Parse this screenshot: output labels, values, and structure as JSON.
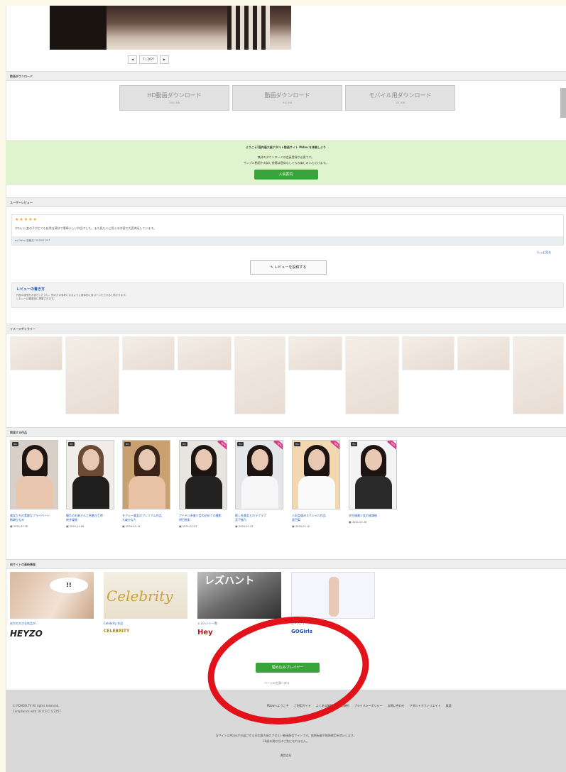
{
  "pager": {
    "prev": "◀",
    "current": "7 / 20??",
    "next": "▶"
  },
  "downloads": {
    "section_title": "動画ダウンロード",
    "buttons": [
      {
        "label": "HD動画ダウンロード",
        "sub": "1080 MB"
      },
      {
        "label": "動画ダウンロード",
        "sub": "640 MB"
      },
      {
        "label": "モバイル用ダウンロード",
        "sub": "320 MB"
      }
    ]
  },
  "promo": {
    "headline": "ようこそ!国内最大級アダルト動画サイト Pbbw を体験しよう",
    "line1": "無料のダウンロードは会員登録が必要です。",
    "line2": "サンプル動画やお試し視聴は登録なしでもお楽しみいただけます。",
    "button": "入会案内"
  },
  "review": {
    "section_title": "ユーザーレビュー",
    "stars": "★★★★★",
    "text": "かわいい女の子がとても自然な演技で素晴らしい作品でした。また見たいと思える内容で大変満足しています。",
    "meta": "by Daisy  投稿日: 2020/07/07",
    "more": "もっと見る",
    "write_button": "レビューを投稿する",
    "guide_title": "レビューの書き方",
    "guide_line1": "作品の感想をお書きください。他の方の参考になるように具体的に書いていただけると助かります。",
    "guide_line2": "レビューは審査後に掲載されます。"
  },
  "gallery": {
    "section_title": "イメージギャラリー"
  },
  "related": {
    "section_title": "関連する作品",
    "items": [
      {
        "title": "美女たちの素敵なプライベート",
        "actress": "桃瀬ひなみ",
        "date": "2021-07-30",
        "badge": "HD",
        "new": false
      },
      {
        "title": "憧れのお姉さんと密着ひと時",
        "actress": "新井優香",
        "date": "2020-11-06",
        "badge": "HD",
        "new": false
      },
      {
        "title": "セクシー美女のプレミアム作品",
        "actress": "大森ひなた",
        "date": "2020-03-13",
        "badge": "HD",
        "new": false
      },
      {
        "title": "アイドル系美少女の初めての撮影",
        "actress": "明日香彩",
        "date": "2021-07-23",
        "badge": "HD",
        "new": true
      },
      {
        "title": "癒し系美女とのラブラブ",
        "actress": "宮下綾乃",
        "date": "2020-07-23",
        "badge": "HD",
        "new": true
      },
      {
        "title": "人気女優のスペシャル作品",
        "actress": "夏目梨",
        "date": "2020-07-10",
        "badge": "HD",
        "new": true
      },
      {
        "title": "学生服美少女の放課後",
        "actress": "",
        "date": "2021-07-16",
        "badge": "HD",
        "new": true
      }
    ]
  },
  "sites": {
    "section_title": "他サイトの最新情報",
    "items": [
      {
        "caption": "ほかの大きな作品が...",
        "logo": "HEYZO",
        "banner": ""
      },
      {
        "caption": "Celebrity 作品",
        "logo": "CELEBRITY",
        "banner": "Celebrity"
      },
      {
        "caption": "レズハントー覧",
        "logo": "Hey",
        "banner": "レズハント"
      },
      {
        "caption": "ユーバナナ",
        "logo": "GOGirls",
        "banner": ""
      }
    ]
  },
  "player": {
    "button": "埋め込みプレイヤー",
    "link": "ページの先頭へ戻る"
  },
  "footer": {
    "copyright": "© PONDO.TV All rights reserved.",
    "compliance": "Compliance with 18 U.S.C. § 2257",
    "links": [
      "Pbbwへようこそ",
      "ご利用ガイド",
      "よくある質問",
      "利用規約",
      "プライバシーポリシー",
      "お問い合わせ",
      "アダルトアフィリエイト",
      "英語"
    ],
    "note1": "当サイトはPbbwがお届けする日本最大級のアダルト動画配信サイトです。無断転載や無断使用を禁止します。",
    "note2": "18歳未満の方はご覧になれません。",
    "bottom_link": "運営会社"
  },
  "colors": {
    "promo_bg": "#dff3cf",
    "green_button": "#3aa33a",
    "link": "#1a5bbf",
    "annotation_circle": "#e3121a",
    "star": "#f5a623"
  }
}
